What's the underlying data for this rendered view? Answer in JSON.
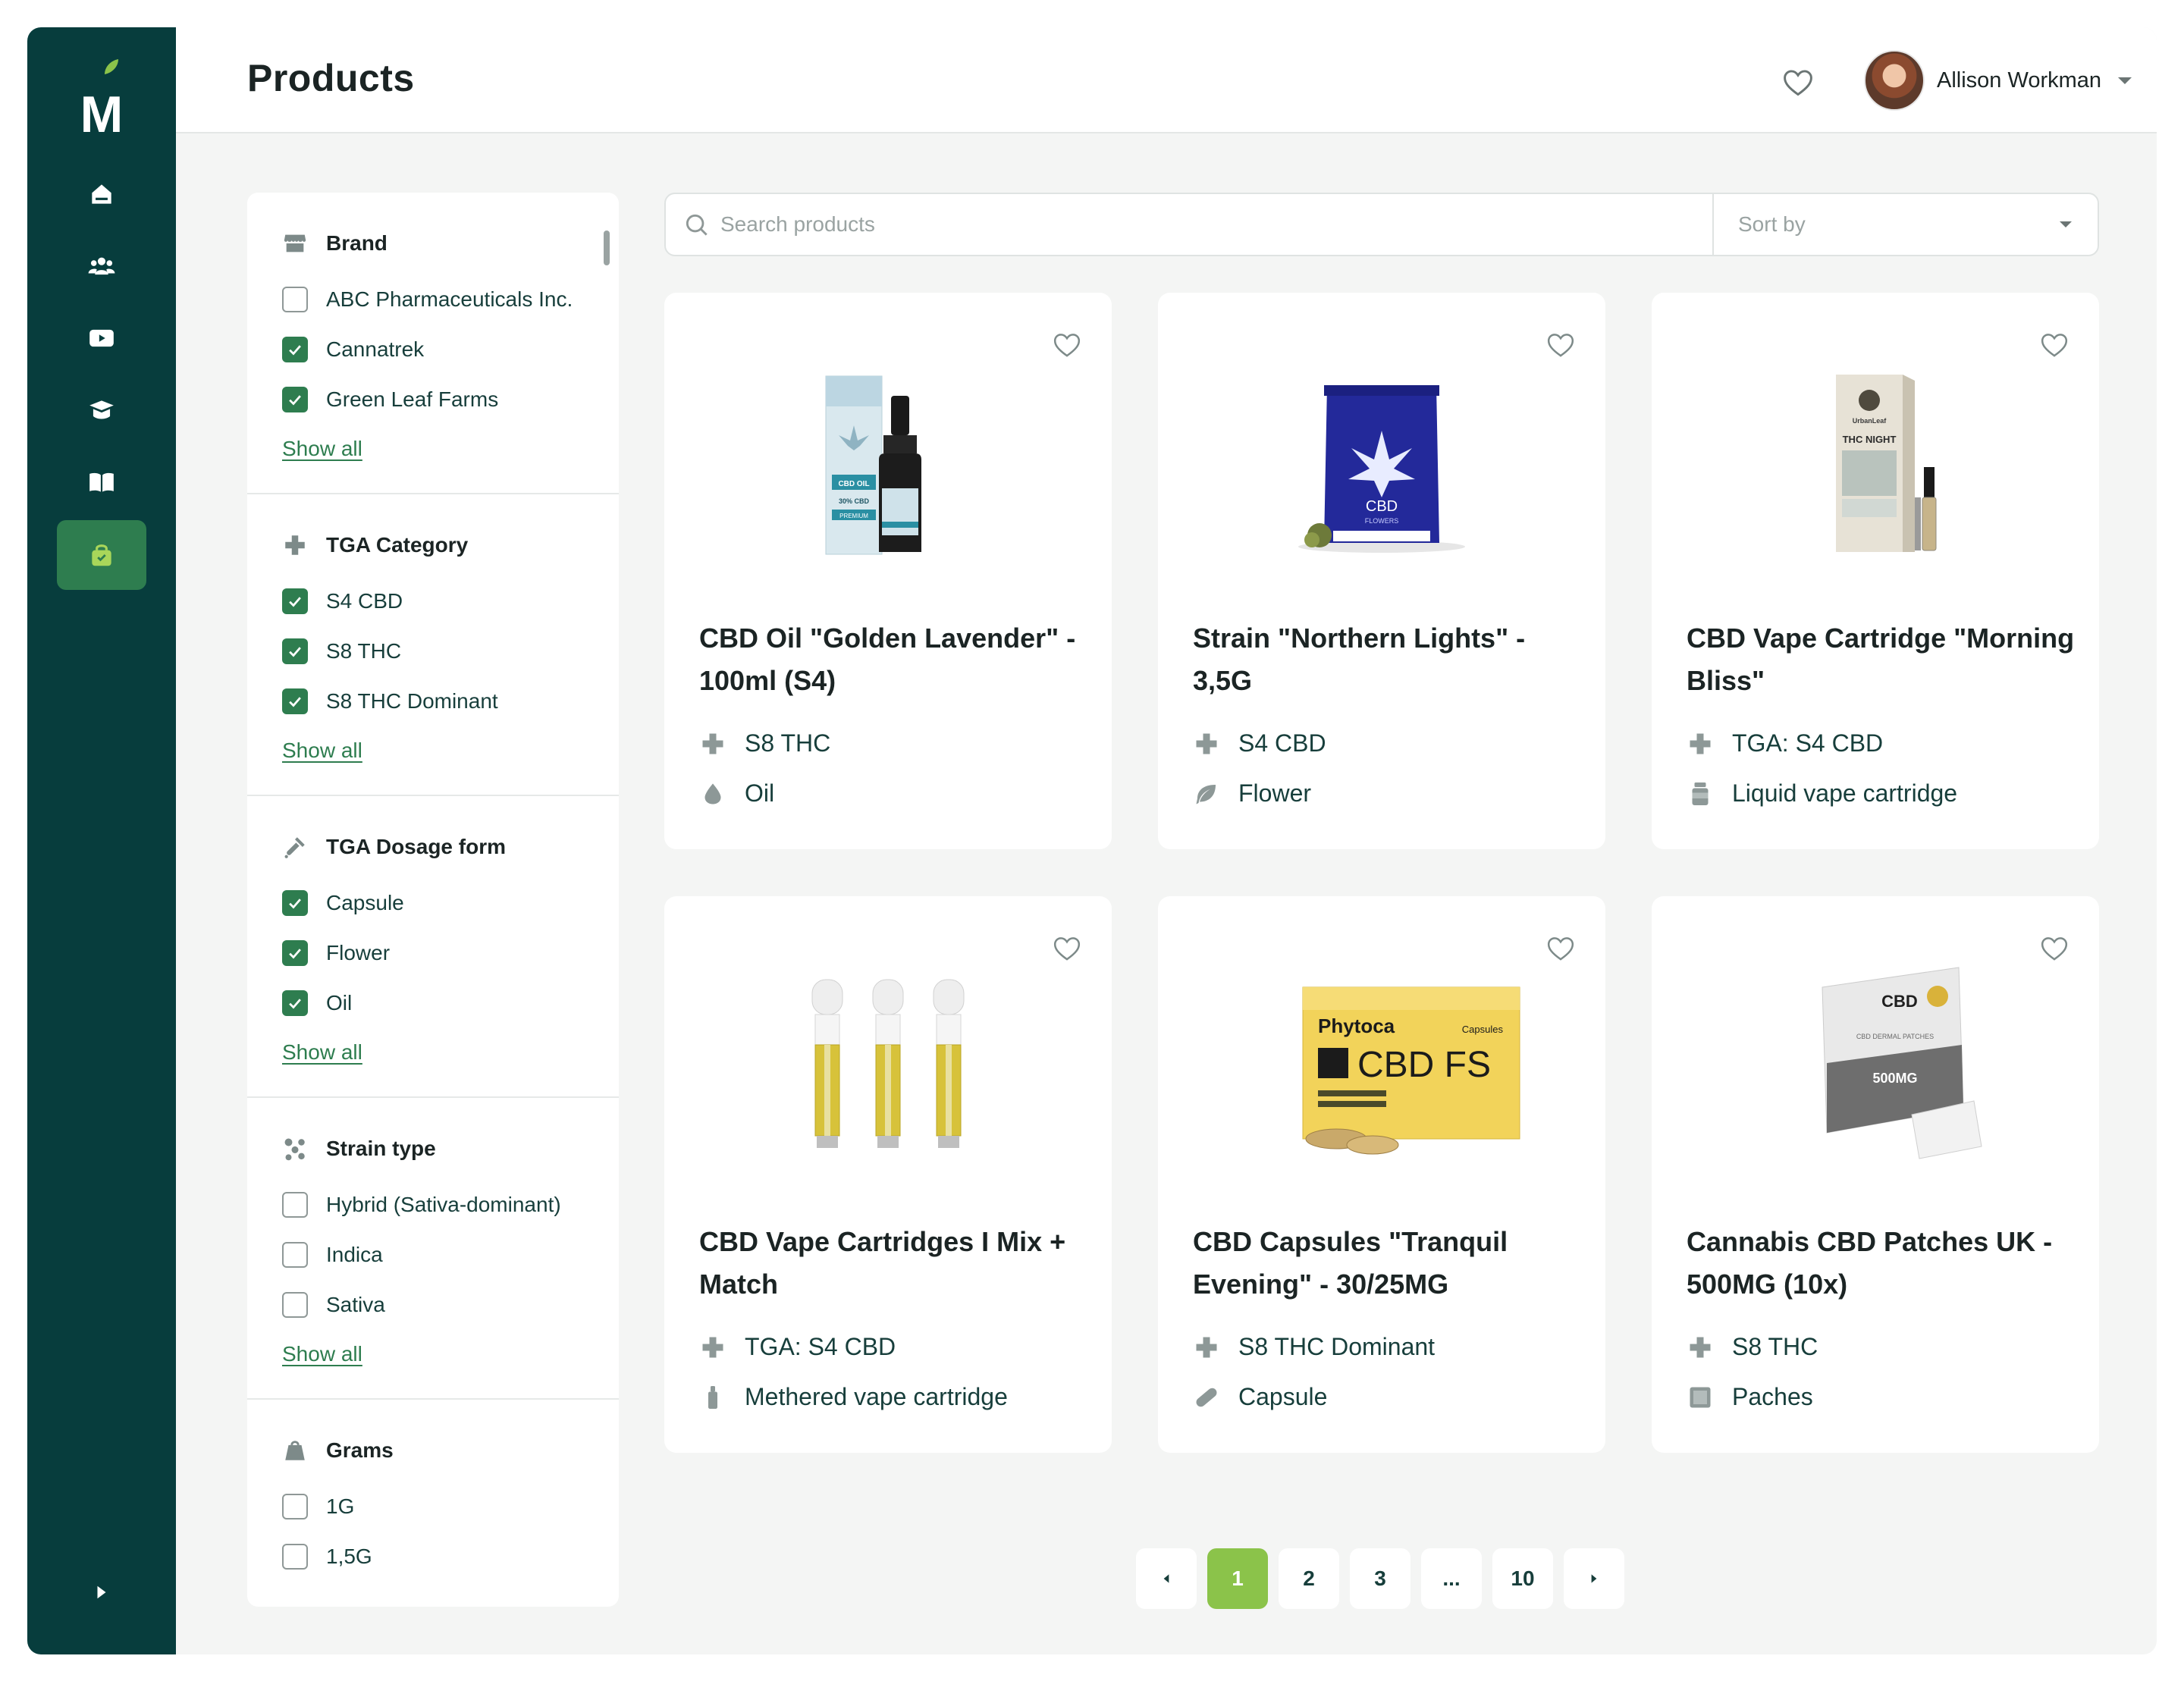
{
  "app": {
    "logo_letter": "M"
  },
  "header": {
    "title": "Products",
    "user_name": "Allison Workman"
  },
  "sidebar": {
    "items": [
      {
        "name": "home",
        "icon": "home-icon",
        "active": false
      },
      {
        "name": "community",
        "icon": "users-icon",
        "active": false
      },
      {
        "name": "videos",
        "icon": "play-icon",
        "active": false
      },
      {
        "name": "education",
        "icon": "graduation-cap-icon",
        "active": false
      },
      {
        "name": "library",
        "icon": "book-icon",
        "active": false
      },
      {
        "name": "products",
        "icon": "shopping-bag-icon",
        "active": true
      }
    ]
  },
  "filters": {
    "brand": {
      "title": "Brand",
      "options": [
        {
          "label": "ABC Pharmaceuticals Inc.",
          "checked": false
        },
        {
          "label": "Cannatrek",
          "checked": true
        },
        {
          "label": "Green Leaf Farms",
          "checked": true
        }
      ],
      "show_all": "Show all"
    },
    "tga_category": {
      "title": "TGA Category",
      "options": [
        {
          "label": "S4 CBD",
          "checked": true
        },
        {
          "label": "S8 THC",
          "checked": true
        },
        {
          "label": "S8 THC Dominant",
          "checked": true
        }
      ],
      "show_all": "Show all"
    },
    "dosage_form": {
      "title": "TGA Dosage form",
      "options": [
        {
          "label": "Capsule",
          "checked": true
        },
        {
          "label": "Flower",
          "checked": true
        },
        {
          "label": "Oil",
          "checked": true
        }
      ],
      "show_all": "Show all"
    },
    "strain_type": {
      "title": "Strain type",
      "options": [
        {
          "label": "Hybrid (Sativa-dominant)",
          "checked": false
        },
        {
          "label": "Indica",
          "checked": false
        },
        {
          "label": "Sativa",
          "checked": false
        }
      ],
      "show_all": "Show all"
    },
    "grams": {
      "title": "Grams",
      "options": [
        {
          "label": "1G",
          "checked": false
        },
        {
          "label": "1,5G",
          "checked": false
        }
      ]
    }
  },
  "search": {
    "placeholder": "Search products",
    "sort_label": "Sort by"
  },
  "products": [
    {
      "title": "CBD Oil \"Golden Lavender\" - 100ml (S4)",
      "category": "S8 THC",
      "form": "Oil",
      "form_icon": "drop-icon"
    },
    {
      "title": "Strain \"Northern Lights\"  - 3,5G",
      "category": "S4 CBD",
      "form": "Flower",
      "form_icon": "leaf-icon"
    },
    {
      "title": "CBD Vape Cartridge \"Morning Bliss\"",
      "category": "TGA: S4 CBD",
      "form": "Liquid vape cartridge",
      "form_icon": "jar-icon"
    },
    {
      "title": "CBD Vape Cartridges I Mix + Match",
      "category": "TGA: S4 CBD",
      "form": "Methered vape cartridge",
      "form_icon": "vape-icon"
    },
    {
      "title": "CBD Capsules \"Tranquil Evening\" - 30/25MG",
      "category": "S8 THC Dominant",
      "form": "Capsule",
      "form_icon": "capsule-icon"
    },
    {
      "title": "Cannabis CBD Patches UK - 500MG (10x)",
      "category": "S8 THC",
      "form": "Paches",
      "form_icon": "patch-icon"
    }
  ],
  "product_images": {
    "oil": {
      "box_line1": "CBD OIL",
      "box_line2": "30% CBD",
      "box_line3": "PREMIUM"
    },
    "flower": {
      "pack_label": "CBD",
      "pack_sub": "FLOWERS"
    },
    "cartridge": {
      "brand": "UrbanLeaf",
      "label": "THC NIGHT"
    },
    "capsules": {
      "brand": "Phytoca",
      "small": "Capsules",
      "name": "CBD FS"
    },
    "patches": {
      "brand": "CBD",
      "sub": "CBD DERMAL PATCHES",
      "dose": "500MG"
    }
  },
  "pagination": {
    "pages": [
      "1",
      "2",
      "3",
      "...",
      "10"
    ],
    "current": "1"
  },
  "colors": {
    "sidebar": "#073d3d",
    "accent": "#2e7d4f",
    "page_active": "#8bc34a",
    "background": "#f4f5f4"
  }
}
